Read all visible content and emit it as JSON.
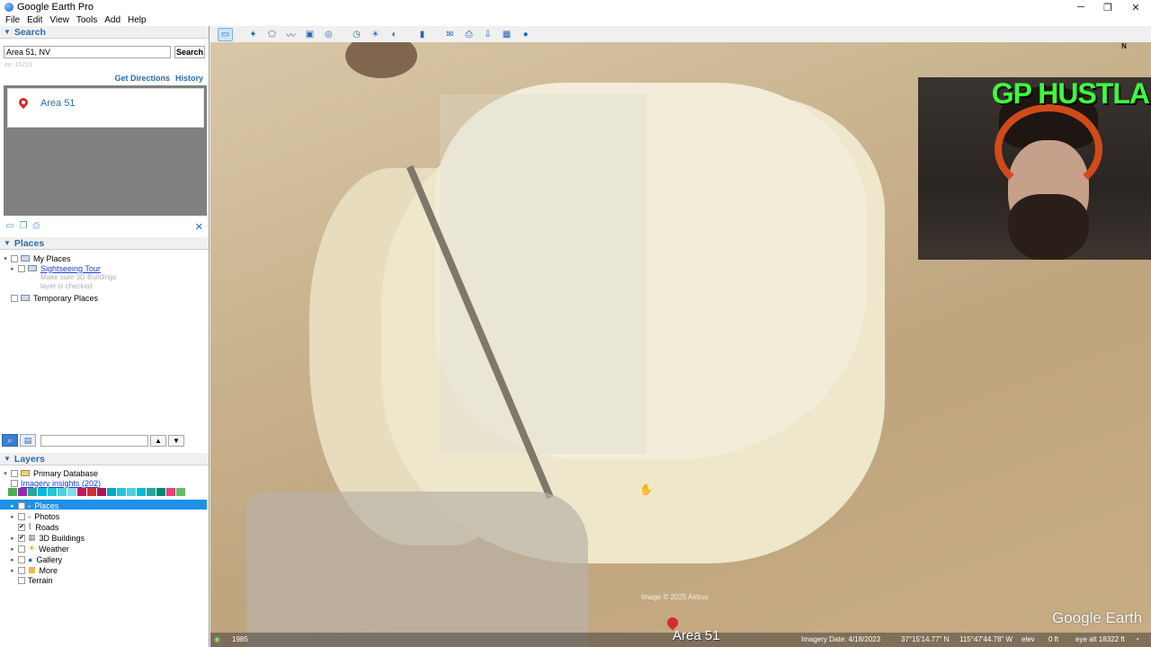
{
  "app": {
    "title": "Google Earth Pro"
  },
  "window_controls": {
    "minimize": "─",
    "maximize": "❐",
    "close": "✕"
  },
  "menu": [
    "File",
    "Edit",
    "View",
    "Tools",
    "Add",
    "Help"
  ],
  "search": {
    "header": "Search",
    "query": "Area 51, NV",
    "button": "Search",
    "hint": "ex: 15213",
    "get_directions": "Get Directions",
    "history": "History",
    "result_title": "Area 51"
  },
  "places": {
    "header": "Places",
    "my_places": "My Places",
    "sightseeing": "Sightseeing Tour",
    "note_line1": "Make sure 3D Buildings",
    "note_line2": "layer is checked",
    "temporary": "Temporary Places"
  },
  "layers": {
    "header": "Layers",
    "primary_db": "Primary Database",
    "imagery_insights": "Imagery insights (202)",
    "items": [
      "Places",
      "Photos",
      "Roads",
      "3D Buildings",
      "Weather",
      "Gallery",
      "More",
      "Terrain"
    ],
    "colors": [
      "#4caf50",
      "#9c27b0",
      "#26a69a",
      "#00bcd4",
      "#26c6da",
      "#4dd0e1",
      "#80deea",
      "#c2185b",
      "#d32f2f",
      "#ad1457",
      "#00acc1",
      "#26c6da",
      "#4dd0e1",
      "#00bcd4",
      "#26a69a",
      "#00897b",
      "#ec407a",
      "#66bb6a"
    ]
  },
  "map": {
    "compass": "N",
    "label": "Area 51",
    "imagery_credit": "Image © 2025 Airbus",
    "watermark": "Google Earth",
    "webcam_overlay": "GP HUSTLA",
    "cursor": "✋"
  },
  "status": {
    "year": "1985",
    "imagery_date": "Imagery Date: 4/18/2023",
    "lat": "37°15'14.77\" N",
    "lon": "115°47'44.78\" W",
    "elev": "elev",
    "elev_value": "0 ft",
    "eye_alt": "eye alt  18322 ft"
  }
}
